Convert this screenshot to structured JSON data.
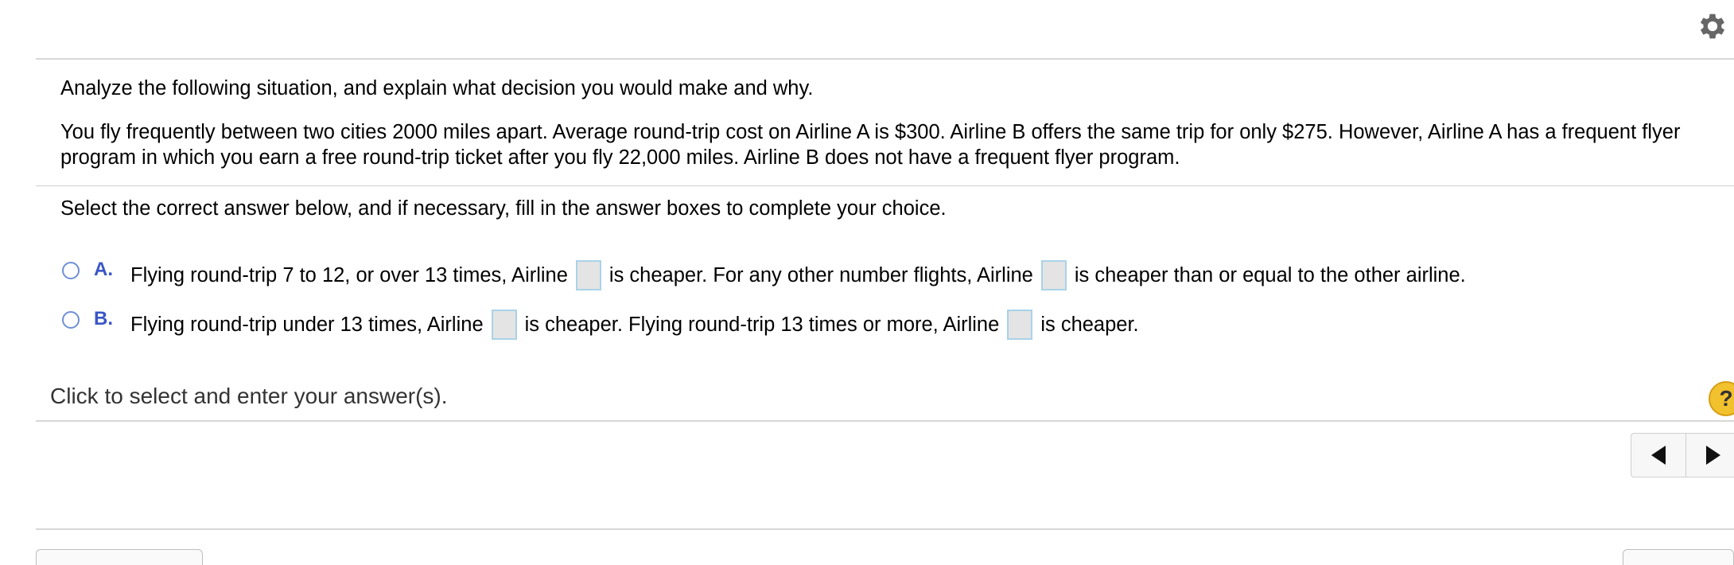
{
  "header": {
    "settings_icon": "gear-icon"
  },
  "question": {
    "instruction": "Analyze the following situation, and explain what decision you would make and why.",
    "problem_line1": "You fly frequently between two cities 2000 miles apart. Average round-trip cost on Airline A is $300. Airline B offers the same trip for only $275. However, Airline A has a frequent flyer",
    "problem_line2": "program in which you earn a free round-trip ticket after you fly 22,000 miles. Airline B does not have a frequent flyer program.",
    "select_prompt": "Select the correct answer below, and if necessary, fill in the answer boxes to complete your choice."
  },
  "choices": [
    {
      "letter": "A.",
      "part1": "Flying round-trip 7 to 12, or over 13 times, Airline",
      "part2": "is cheaper. For any other number flights, Airline",
      "part3": "is cheaper than or equal to the other airline.",
      "box1_value": "",
      "box2_value": ""
    },
    {
      "letter": "B.",
      "part1": "Flying round-trip under 13 times, Airline",
      "part2": "is cheaper. Flying round-trip 13 times or more, Airline",
      "part3": "is cheaper.",
      "box1_value": "",
      "box2_value": ""
    }
  ],
  "footer": {
    "status": "Click to select and enter your answer(s).",
    "help_label": "?"
  }
}
